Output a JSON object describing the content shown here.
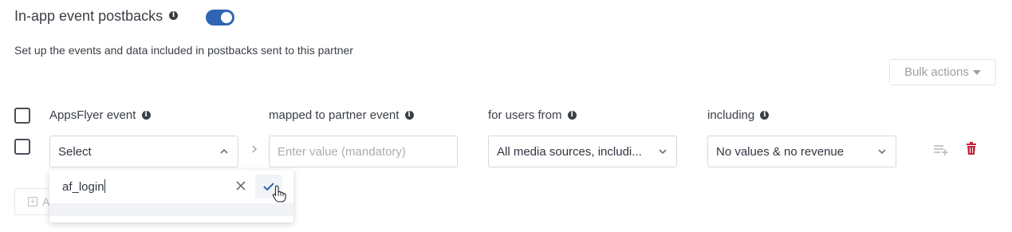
{
  "section": {
    "title": "In-app event postbacks",
    "subtitle": "Set up the events and data included in postbacks sent to this partner",
    "toggle_on": true
  },
  "toolbar": {
    "bulk_actions_label": "Bulk actions"
  },
  "table": {
    "headers": {
      "appsflyer_event": "AppsFlyer event",
      "partner_event": "mapped to partner event",
      "users_from": "for users from",
      "including": "including"
    },
    "row": {
      "event_select_value": "Select",
      "partner_event_placeholder": "Enter value (mandatory)",
      "users_from_value": "All media sources, includi...",
      "including_value": "No values & no revenue"
    }
  },
  "dropdown": {
    "input_value": "af_login"
  },
  "add_button": {
    "label": "A"
  },
  "colors": {
    "accent": "#2f66b3",
    "delete": "#c8223a",
    "border": "#d5d8dd"
  },
  "icons": [
    "info-icon",
    "chevron-up-icon",
    "chevron-down-icon",
    "chevron-right-icon",
    "add-row-icon",
    "trash-icon",
    "close-icon",
    "check-icon",
    "hand-cursor-icon"
  ]
}
